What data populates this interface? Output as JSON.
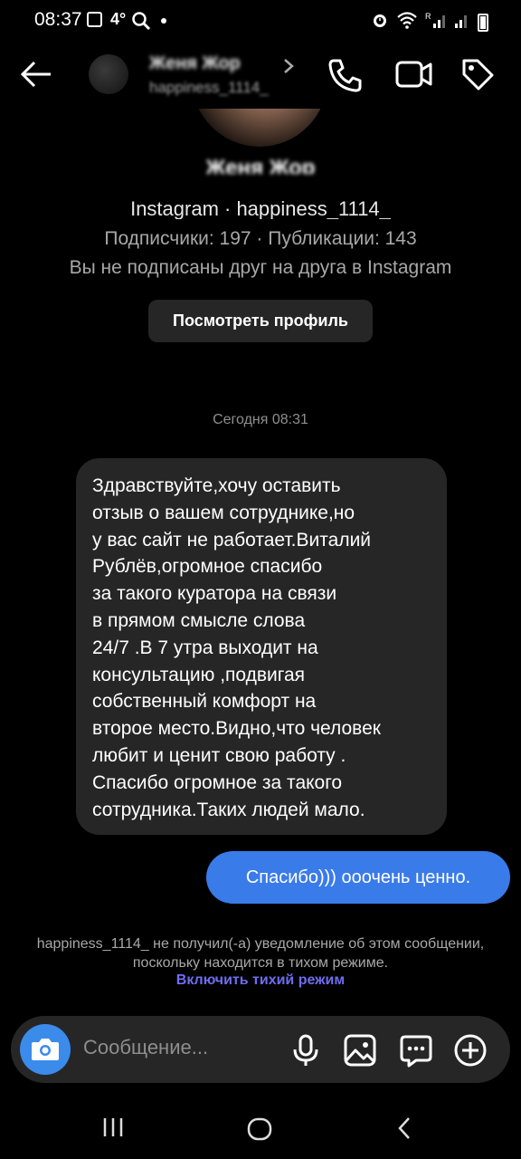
{
  "status_bar": {
    "time": "08:37",
    "temp": "4°"
  },
  "header": {
    "name": "Женя Жор",
    "username": "happiness_1114_"
  },
  "profile": {
    "fullname": "Женя Жор",
    "instagram": "Instagram · happiness_1114_",
    "stats": "Подписчики: 197 · Публикации: 143",
    "follow_status": "Вы не подписаны друг на друга в Instagram",
    "view_profile_label": "Посмотреть профиль"
  },
  "chat": {
    "timestamp": "Сегодня 08:31",
    "incoming": "Здравствуйте,хочу оставить\nотзыв о вашем сотруднике,но\nу вас сайт не работает.Виталий\nРублёв,огромное спасибо\nза такого куратора на связи\nв прямом смысле слова\n24/7 .В 7 утра   выходит на\nконсультацию ,подвигая\nсобственный комфорт на\nвторое место.Видно,что человек\nлюбит и ценит свою работу .\nСпасибо огромное за такого\nсотрудника.Таких людей мало.",
    "outgoing": "Спасибо))) ооочень ценно."
  },
  "notice": {
    "text": "happiness_1114_ не получил(-а) уведомление об этом сообщении, поскольку находится в тихом режиме.",
    "link": "Включить тихий режим"
  },
  "composer": {
    "placeholder": "Сообщение..."
  },
  "colors": {
    "accent_blue": "#3a7bea",
    "link_purple": "#6e6df0",
    "bubble_gray": "#262626"
  },
  "icons": [
    "back-arrow-icon",
    "phone-icon",
    "video-camera-icon",
    "tag-icon",
    "camera-icon",
    "microphone-icon",
    "gallery-icon",
    "sticker-icon",
    "plus-icon"
  ]
}
